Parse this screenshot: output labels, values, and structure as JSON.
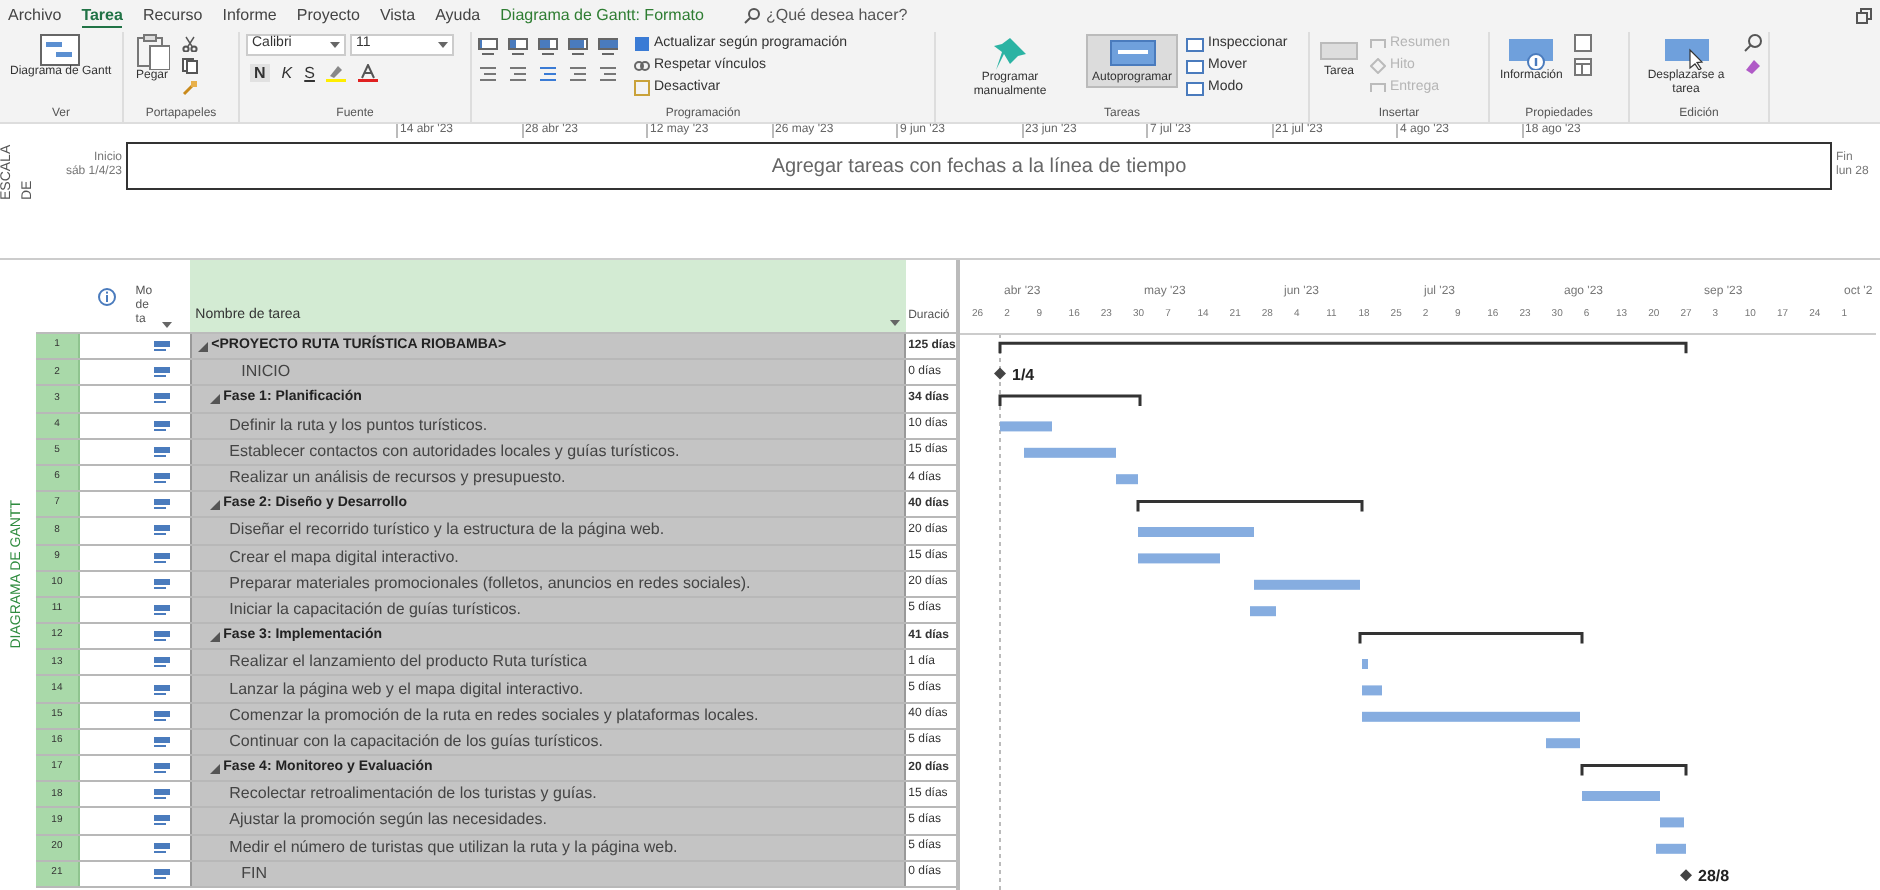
{
  "menu_tabs": [
    {
      "label": "Archivo",
      "selected": false
    },
    {
      "label": "Tarea",
      "selected": true
    },
    {
      "label": "Recurso",
      "selected": false
    },
    {
      "label": "Informe",
      "selected": false
    },
    {
      "label": "Proyecto",
      "selected": false
    },
    {
      "label": "Vista",
      "selected": false
    },
    {
      "label": "Ayuda",
      "selected": false
    },
    {
      "label": "Diagrama de Gantt: Formato",
      "selected": false
    }
  ],
  "search": {
    "placeholder": "¿Qué desea hacer?"
  },
  "ribbon": {
    "view": {
      "label": "Ver",
      "button": "Diagrama de Gantt"
    },
    "clipboard": {
      "label": "Portapapeles",
      "button": "Pegar"
    },
    "font": {
      "label": "Fuente",
      "family": "Calibri",
      "size": "11",
      "styles": [
        "N",
        "K",
        "S"
      ]
    },
    "schedule": {
      "label": "Programación",
      "commands": [
        {
          "label": "Actualizar según programación",
          "disabled": false
        },
        {
          "label": "Respetar vínculos",
          "disabled": false
        },
        {
          "label": "Desactivar",
          "disabled": false
        }
      ]
    },
    "tasks": {
      "label": "Tareas",
      "buttons": [
        {
          "label": "Programar manualmente",
          "selected": false
        },
        {
          "label": "Autoprogramar",
          "selected": true
        }
      ],
      "commands": [
        {
          "label": "Inspeccionar",
          "disabled": false
        },
        {
          "label": "Mover",
          "disabled": false
        },
        {
          "label": "Modo",
          "disabled": false
        }
      ]
    },
    "insert": {
      "label": "Insertar",
      "button": "Tarea",
      "commands": [
        {
          "label": "Resumen",
          "disabled": true
        },
        {
          "label": "Hito",
          "disabled": true
        },
        {
          "label": "Entrega",
          "disabled": true
        }
      ]
    },
    "properties": {
      "label": "Propiedades",
      "button": "Información"
    },
    "editing": {
      "label": "Edición",
      "button": "Desplazarse a tarea"
    }
  },
  "timeline": {
    "side_label": "ESCALA DE",
    "start_label": "Inicio",
    "start_date": "sáb 1/4/23",
    "end_label": "Fin",
    "end_date": "lun 28",
    "prompt": "Agregar tareas con fechas a la línea de tiempo",
    "dates": [
      "14 abr '23",
      "28 abr '23",
      "12 may '23",
      "26 may '23",
      "9 jun '23",
      "23 jun '23",
      "7 jul '23",
      "21 jul '23",
      "4 ago '23",
      "18 ago '23"
    ]
  },
  "view_label": "DIAGRAMA DE GANTT",
  "table": {
    "columns": [
      "Mo de ta",
      "Nombre de tarea",
      "Duració"
    ],
    "tasks": [
      {
        "id": "1",
        "kind": "summary",
        "name": "<PROYECTO RUTA TURÍSTICA RIOBAMBA>",
        "duration": "125 días",
        "expanded": true,
        "children": [
          {
            "id": "2",
            "kind": "milestone",
            "name": "INICIO",
            "duration": "0 días",
            "bar_label": "1/4"
          },
          {
            "id": "3",
            "kind": "summary",
            "name": "Fase 1: Planificación",
            "duration": "34 días",
            "expanded": true,
            "children": [
              {
                "id": "4",
                "kind": "task",
                "name": "Definir la ruta y los puntos turísticos.",
                "duration": "10 días"
              },
              {
                "id": "5",
                "kind": "task",
                "name": "Establecer contactos con autoridades locales y guías turísticos.",
                "duration": "15 días"
              },
              {
                "id": "6",
                "kind": "task",
                "name": "Realizar un análisis de recursos y presupuesto.",
                "duration": "4 días"
              }
            ]
          },
          {
            "id": "7",
            "kind": "summary",
            "name": "Fase 2: Diseño y Desarrollo",
            "duration": "40 días",
            "expanded": true,
            "children": [
              {
                "id": "8",
                "kind": "task",
                "name": "Diseñar el recorrido turístico y la estructura de la página web.",
                "duration": "20 días"
              },
              {
                "id": "9",
                "kind": "task",
                "name": "Crear el mapa digital interactivo.",
                "duration": "15 días"
              },
              {
                "id": "10",
                "kind": "task",
                "name": "Preparar materiales promocionales (folletos, anuncios en redes sociales).",
                "duration": "20 días"
              },
              {
                "id": "11",
                "kind": "task",
                "name": "Iniciar la capacitación de guías turísticos.",
                "duration": "5 días"
              }
            ]
          },
          {
            "id": "12",
            "kind": "summary",
            "name": "Fase 3: Implementación",
            "duration": "41 días",
            "expanded": true,
            "children": [
              {
                "id": "13",
                "kind": "task",
                "name": "Realizar el lanzamiento del producto Ruta turística",
                "duration": "1 día"
              },
              {
                "id": "14",
                "kind": "task",
                "name": "Lanzar la página web y el mapa digital interactivo.",
                "duration": "5 días"
              },
              {
                "id": "15",
                "kind": "task",
                "name": "Comenzar la promoción de la ruta en redes sociales y plataformas locales.",
                "duration": "40 días"
              },
              {
                "id": "16",
                "kind": "task",
                "name": "Continuar con la capacitación de los guías turísticos.",
                "duration": "5 días"
              }
            ]
          },
          {
            "id": "17",
            "kind": "summary",
            "name": "Fase 4: Monitoreo y Evaluación",
            "duration": "20 días",
            "expanded": true,
            "children": [
              {
                "id": "18",
                "kind": "task",
                "name": "Recolectar retroalimentación de los turistas y guías.",
                "duration": "15 días"
              },
              {
                "id": "19",
                "kind": "task",
                "name": "Ajustar la promoción según las necesidades.",
                "duration": "5 días"
              },
              {
                "id": "20",
                "kind": "task",
                "name": "Medir el número de turistas que utilizan la ruta y la página web.",
                "duration": "5 días"
              }
            ]
          },
          {
            "id": "21",
            "kind": "milestone",
            "name": "FIN",
            "duration": "0 días",
            "bar_label": "28/8"
          }
        ]
      }
    ]
  },
  "gantt": {
    "months": [
      "abr '23",
      "may '23",
      "jun '23",
      "jul '23",
      "ago '23",
      "sep '23",
      "oct '2"
    ],
    "days": [
      "26",
      "2",
      "9",
      "16",
      "23",
      "30",
      "7",
      "14",
      "21",
      "28",
      "4",
      "11",
      "18",
      "25",
      "2",
      "9",
      "16",
      "23",
      "30",
      "6",
      "13",
      "20",
      "27",
      "3",
      "10",
      "17",
      "24",
      "1"
    ]
  }
}
